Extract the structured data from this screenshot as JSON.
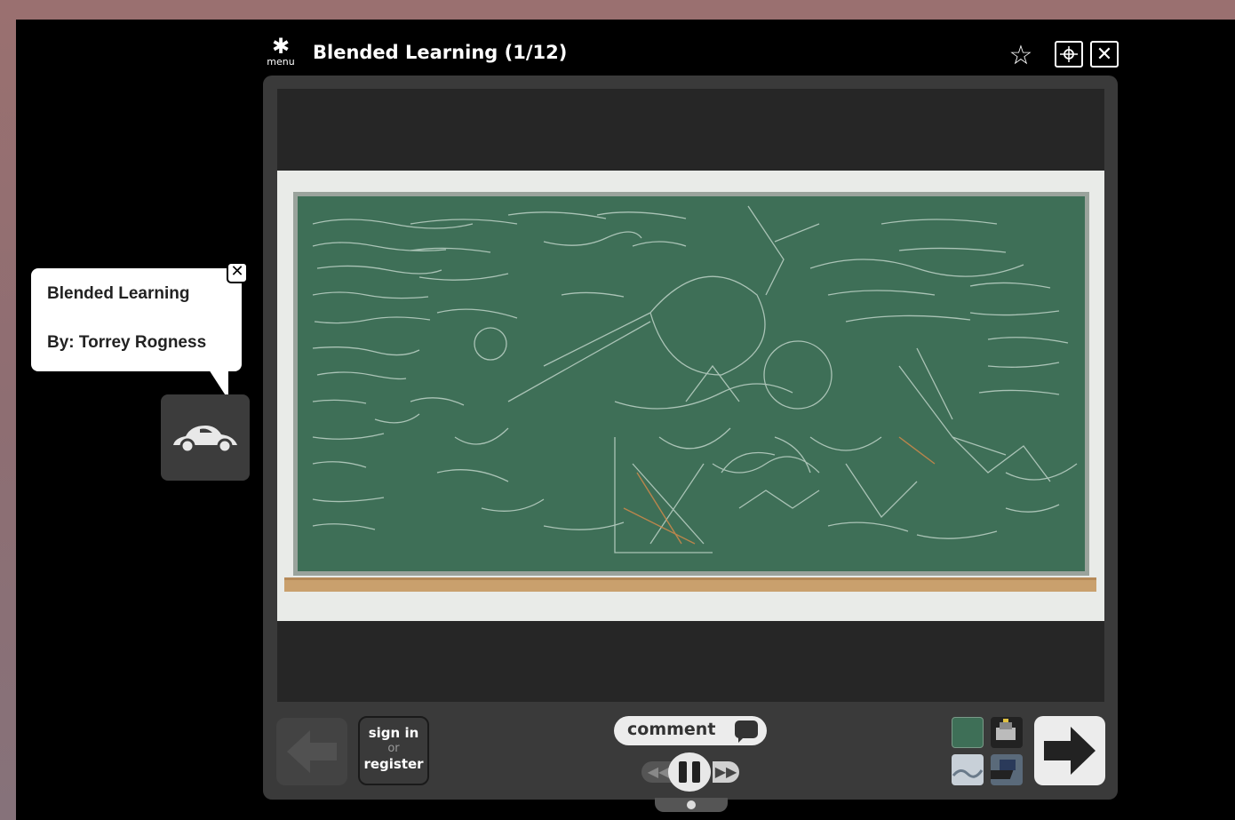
{
  "header": {
    "menu_label": "menu",
    "title": "Blended Learning (1/12)"
  },
  "tooltip": {
    "title": "Blended Learning",
    "author": "By: Torrey Rogness"
  },
  "controls": {
    "signin": "sign in",
    "or": "or",
    "register": "register",
    "comment": "comment",
    "progress_fraction": 0.5
  },
  "icons": {
    "menu": "gear-icon",
    "star": "star-icon",
    "fit": "fit-screen-icon",
    "close": "close-icon",
    "car": "car-icon",
    "prev": "arrow-left-icon",
    "next": "arrow-right-icon",
    "comment": "speech-bubble-icon"
  },
  "colors": {
    "background": "#9a7070",
    "stage": "#000000",
    "viewer": "#3a3a3a",
    "chalkboard": "#3e6f57"
  }
}
